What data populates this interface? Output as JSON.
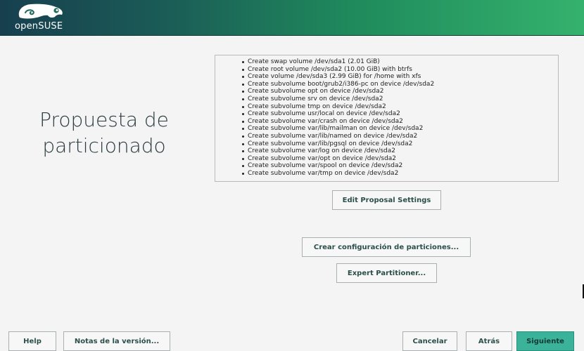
{
  "header": {
    "brand": "openSUSE",
    "colors": {
      "gradient_start": "#173f4f",
      "gradient_end": "#35b26d"
    },
    "logo_icon": "chameleon-icon"
  },
  "page": {
    "title_line1": "Propuesta de",
    "title_line2": "particionado"
  },
  "summary": {
    "items": [
      "Create swap volume /dev/sda1 (2.01 GiB)",
      "Create root volume /dev/sda2 (10.00 GiB) with btrfs",
      "Create volume /dev/sda3 (2.99 GiB) for /home with xfs",
      "Create subvolume boot/grub2/i386-pc on device /dev/sda2",
      "Create subvolume opt on device /dev/sda2",
      "Create subvolume srv on device /dev/sda2",
      "Create subvolume tmp on device /dev/sda2",
      "Create subvolume usr/local on device /dev/sda2",
      "Create subvolume var/crash on device /dev/sda2",
      "Create subvolume var/lib/mailman on device /dev/sda2",
      "Create subvolume var/lib/named on device /dev/sda2",
      "Create subvolume var/lib/pgsql on device /dev/sda2",
      "Create subvolume var/log on device /dev/sda2",
      "Create subvolume var/opt on device /dev/sda2",
      "Create subvolume var/spool on device /dev/sda2",
      "Create subvolume var/tmp on device /dev/sda2"
    ]
  },
  "actions": {
    "edit_proposal": "Edit Proposal Settings",
    "create_config": "Crear configuración de particiones...",
    "expert_partitioner": "Expert Partitioner..."
  },
  "footer": {
    "help": "Help",
    "release_notes": "Notas de la versión...",
    "cancel": "Cancelar",
    "back": "Atrás",
    "next": "Siguiente",
    "primary_color": "#3ab39a"
  }
}
